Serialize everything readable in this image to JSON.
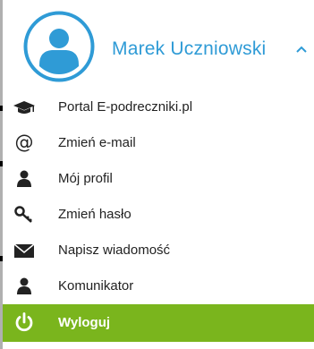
{
  "user": {
    "name": "Marek Uczniowski"
  },
  "colors": {
    "accent": "#2f9bd6",
    "logout_bg": "#7ab51d"
  },
  "menu": {
    "items": [
      {
        "label": "Portal E-podreczniki.pl",
        "icon": "graduation-cap-icon"
      },
      {
        "label": "Zmień e-mail",
        "icon": "at-sign-icon"
      },
      {
        "label": "Mój profil",
        "icon": "user-icon"
      },
      {
        "label": "Zmień hasło",
        "icon": "key-icon"
      },
      {
        "label": "Napisz wiadomość",
        "icon": "envelope-icon"
      },
      {
        "label": "Komunikator",
        "icon": "user-icon"
      },
      {
        "label": "Wyloguj",
        "icon": "power-icon"
      }
    ]
  }
}
